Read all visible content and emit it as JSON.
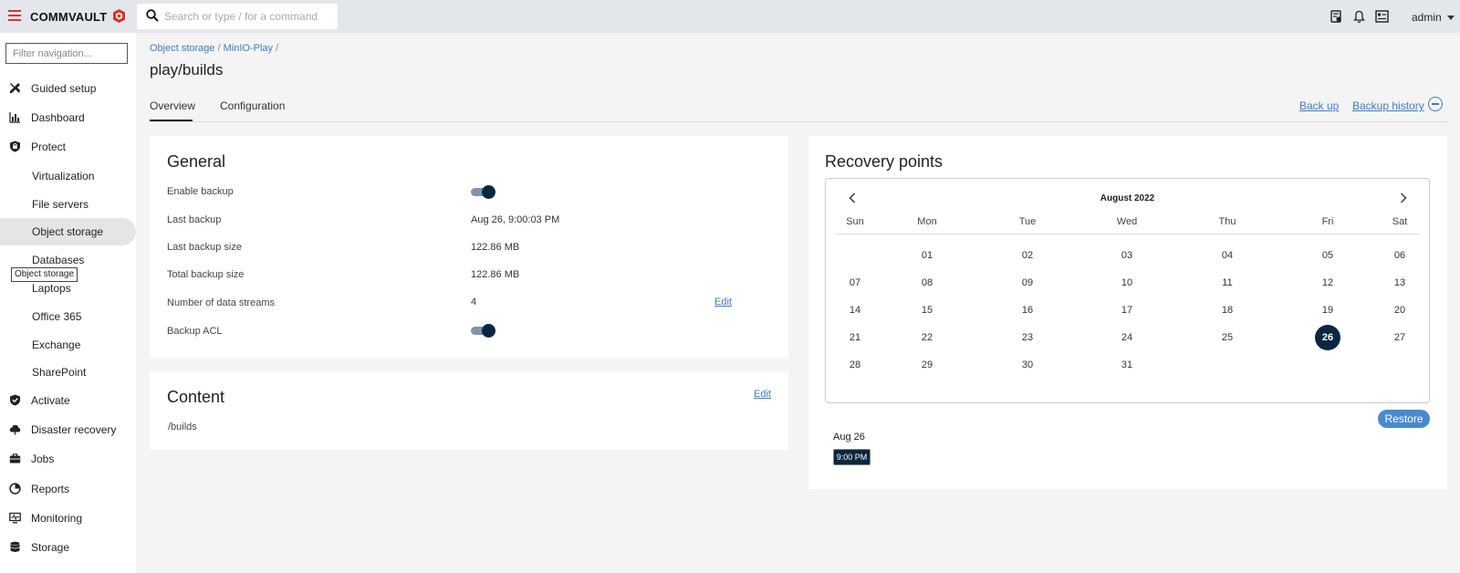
{
  "topbar": {
    "brand": "COMMVAULT",
    "search_placeholder": "Search or type / for a command",
    "user": "admin"
  },
  "sidebar": {
    "filter_placeholder": "Filter navigation...",
    "items": [
      {
        "label": "Guided setup",
        "icon": "tools-icon"
      },
      {
        "label": "Dashboard",
        "icon": "chart-icon"
      },
      {
        "label": "Protect",
        "icon": "shield-lock-icon"
      },
      {
        "label": "Virtualization"
      },
      {
        "label": "File servers"
      },
      {
        "label": "Object storage"
      },
      {
        "label": "Databases"
      },
      {
        "label": "Laptops"
      },
      {
        "label": "Office 365"
      },
      {
        "label": "Exchange"
      },
      {
        "label": "SharePoint"
      },
      {
        "label": "Activate",
        "icon": "shield-check-icon"
      },
      {
        "label": "Disaster recovery",
        "icon": "cloud-recovery-icon"
      },
      {
        "label": "Jobs",
        "icon": "briefcase-icon"
      },
      {
        "label": "Reports",
        "icon": "reports-icon"
      },
      {
        "label": "Monitoring",
        "icon": "monitor-icon"
      },
      {
        "label": "Storage",
        "icon": "database-icon"
      }
    ],
    "tooltip": "Object storage"
  },
  "breadcrumb": [
    "Object storage",
    "MinIO-Play"
  ],
  "page_title": "play/builds",
  "tabs": [
    "Overview",
    "Configuration"
  ],
  "actions": {
    "backup": "Back up",
    "history": "Backup history"
  },
  "general": {
    "title": "General",
    "enable_backup_label": "Enable backup",
    "enable_backup": true,
    "last_backup_label": "Last backup",
    "last_backup": "Aug 26, 9:00:03 PM",
    "last_backup_size_label": "Last backup size",
    "last_backup_size": "122.86 MB",
    "total_backup_size_label": "Total backup size",
    "total_backup_size": "122.86 MB",
    "streams_label": "Number of data streams",
    "streams": "4",
    "edit": "Edit",
    "acl_label": "Backup ACL",
    "acl": true
  },
  "content": {
    "title": "Content",
    "edit": "Edit",
    "path": "/builds"
  },
  "recovery": {
    "title": "Recovery points",
    "month": "August 2022",
    "weekdays": [
      "Sun",
      "Mon",
      "Tue",
      "Wed",
      "Thu",
      "Fri",
      "Sat"
    ],
    "weeks": [
      [
        "",
        "01",
        "02",
        "03",
        "04",
        "05",
        "06"
      ],
      [
        "07",
        "08",
        "09",
        "10",
        "11",
        "12",
        "13"
      ],
      [
        "14",
        "15",
        "16",
        "17",
        "18",
        "19",
        "20"
      ],
      [
        "21",
        "22",
        "23",
        "24",
        "25",
        "26",
        "27"
      ],
      [
        "28",
        "29",
        "30",
        "31",
        "",
        "",
        ""
      ]
    ],
    "selected": "26",
    "restore": "Restore",
    "point_date": "Aug 26",
    "point_time": "9:00 PM"
  },
  "colors": {
    "accent": "#3e7cc4",
    "brand": "#d9342b",
    "dark": "#0b2740"
  }
}
